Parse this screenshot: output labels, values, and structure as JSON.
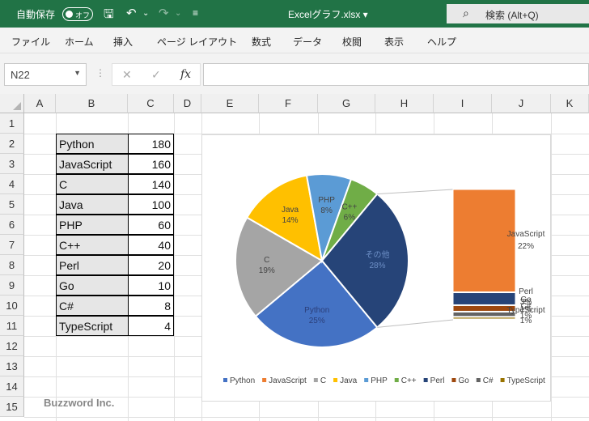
{
  "titlebar": {
    "autosave_label": "自動保存",
    "toggle_label": "オフ",
    "filename": "Excelグラフ.xlsx ▾",
    "search_label": "検索 (Alt+Q)"
  },
  "menu": [
    "ファイル",
    "ホーム",
    "挿入",
    "ページ レイアウト",
    "数式",
    "データ",
    "校閲",
    "表示",
    "ヘルプ"
  ],
  "formula": {
    "namebox": "N22",
    "fx": "fx"
  },
  "columns": [
    "A",
    "B",
    "C",
    "D",
    "E",
    "F",
    "G",
    "H",
    "I",
    "J",
    "K"
  ],
  "rows": [
    "1",
    "2",
    "3",
    "4",
    "5",
    "6",
    "7",
    "8",
    "9",
    "10",
    "11",
    "12",
    "13",
    "14",
    "15"
  ],
  "table": [
    {
      "lang": "Python",
      "value": "180"
    },
    {
      "lang": "JavaScript",
      "value": "160"
    },
    {
      "lang": "C",
      "value": "140"
    },
    {
      "lang": "Java",
      "value": "100"
    },
    {
      "lang": "PHP",
      "value": "60"
    },
    {
      "lang": "C++",
      "value": "40"
    },
    {
      "lang": "Perl",
      "value": "20"
    },
    {
      "lang": "Go",
      "value": "10"
    },
    {
      "lang": "C#",
      "value": "8"
    },
    {
      "lang": "TypeScript",
      "value": "4"
    }
  ],
  "chart_data": {
    "type": "pie",
    "subtype": "bar-of-pie",
    "categories": [
      "Python",
      "JavaScript",
      "C",
      "Java",
      "PHP",
      "C++",
      "Perl",
      "Go",
      "C#",
      "TypeScript"
    ],
    "values": [
      180,
      160,
      140,
      100,
      60,
      40,
      20,
      10,
      8,
      4
    ],
    "colors": [
      "#4472c4",
      "#ed7d31",
      "#a5a5a5",
      "#ffc000",
      "#5b9bd5",
      "#70ad47",
      "#264478",
      "#9e480e",
      "#636363",
      "#997300"
    ],
    "pie_labels": [
      {
        "name": "Python",
        "pct": "25%"
      },
      {
        "name": "C",
        "pct": "19%"
      },
      {
        "name": "Java",
        "pct": "14%"
      },
      {
        "name": "PHP",
        "pct": "8%"
      },
      {
        "name": "C++",
        "pct": "6%"
      },
      {
        "name": "その他",
        "pct": "28%"
      }
    ],
    "bar_labels": [
      {
        "name": "JavaScript",
        "pct": "22%"
      },
      {
        "name": "Perl",
        "pct": "3%"
      },
      {
        "name": "Go",
        "pct": "1%"
      },
      {
        "name": "C#",
        "pct": "1%"
      },
      {
        "name": "TypeScript",
        "pct": "1%"
      }
    ],
    "legend_position": "bottom",
    "title": ""
  },
  "watermark": "Buzzword Inc."
}
